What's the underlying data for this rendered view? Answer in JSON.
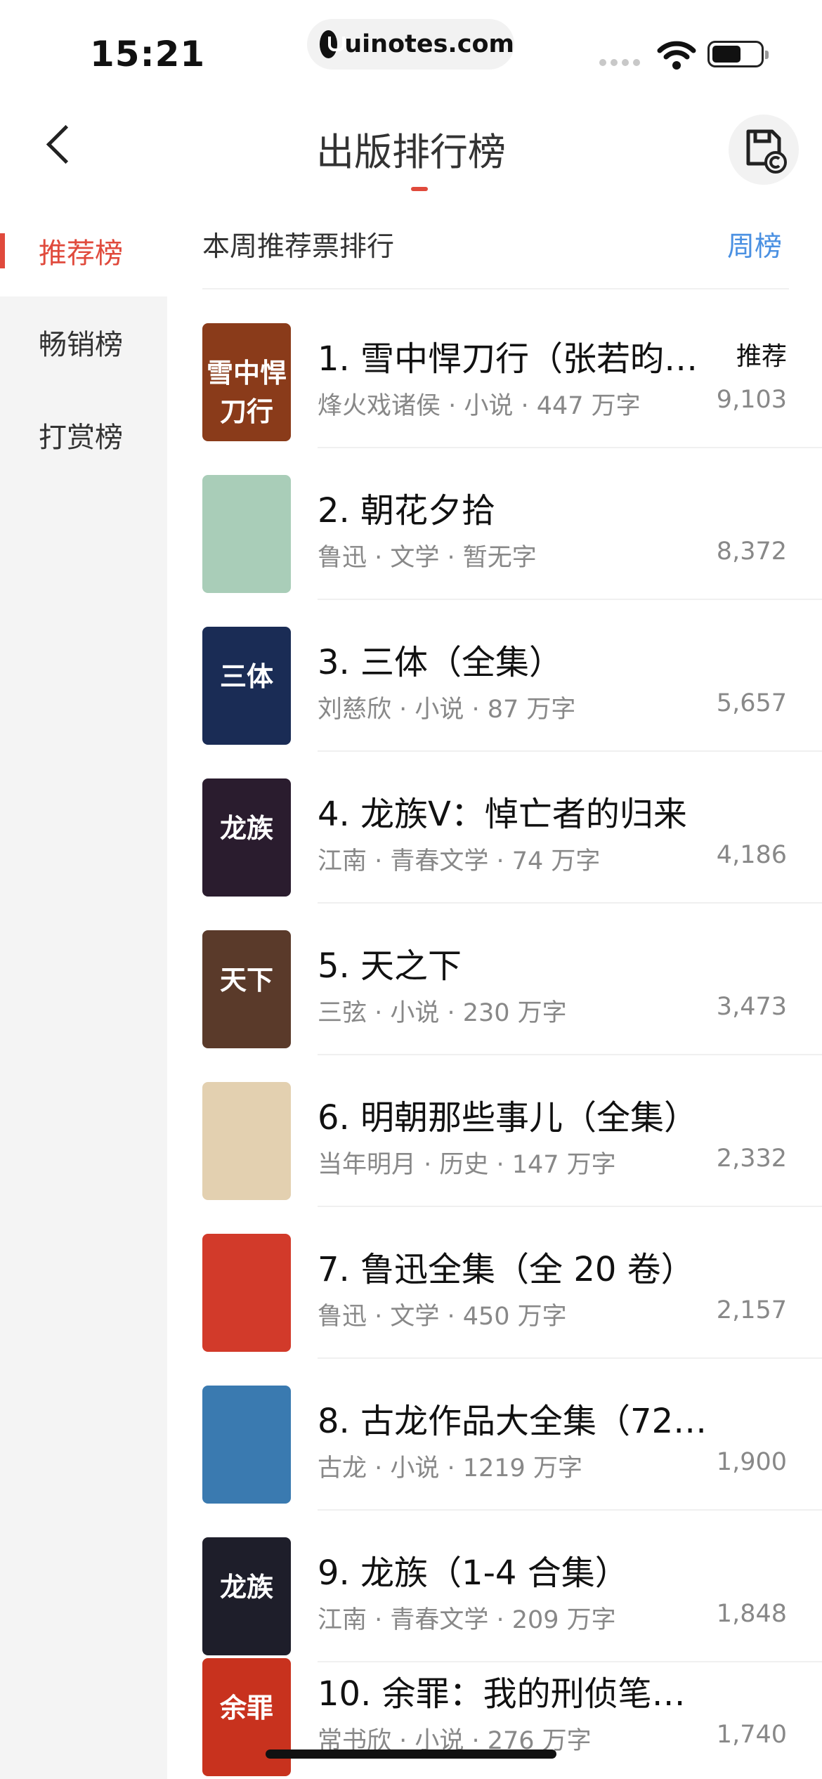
{
  "status_bar": {
    "time": "15:21",
    "url": "uinotes.com"
  },
  "header": {
    "title": "出版排行榜",
    "back_icon": "chevron-left-icon",
    "action_icon": "save-copyright-icon"
  },
  "sidebar": {
    "items": [
      {
        "label": "推荐榜",
        "active": true
      },
      {
        "label": "畅销榜",
        "active": false
      },
      {
        "label": "打赏榜",
        "active": false
      }
    ]
  },
  "section": {
    "title": "本周推荐票排行",
    "switch_label": "周榜"
  },
  "books": [
    {
      "name": "1. 雪中悍刀行（张若昀、…",
      "meta": "烽火戏诸侯 · 小说 · 447 万字",
      "tag": "推荐",
      "count": "9,103",
      "cover_color": "#8a3b1a",
      "cover_text": "雪中悍刀行"
    },
    {
      "name": "2. 朝花夕拾",
      "meta": "鲁迅 · 文学 · 暂无字",
      "tag": "",
      "count": "8,372",
      "cover_color": "#a9cdb8",
      "cover_text": ""
    },
    {
      "name": "3. 三体（全集）",
      "meta": "刘慈欣 · 小说 · 87 万字",
      "tag": "",
      "count": "5,657",
      "cover_color": "#1a2c55",
      "cover_text": "三体"
    },
    {
      "name": "4. 龙族Ⅴ：悼亡者的归来",
      "meta": "江南 · 青春文学 · 74 万字",
      "tag": "",
      "count": "4,186",
      "cover_color": "#2a1c2e",
      "cover_text": "龙族"
    },
    {
      "name": "5. 天之下",
      "meta": "三弦 · 小说 · 230 万字",
      "tag": "",
      "count": "3,473",
      "cover_color": "#5a3a2a",
      "cover_text": "天下"
    },
    {
      "name": "6. 明朝那些事儿（全集）",
      "meta": "当年明月 · 历史 · 147 万字",
      "tag": "",
      "count": "2,332",
      "cover_color": "#e3d0b0",
      "cover_text": ""
    },
    {
      "name": "7. 鲁迅全集（全 20 卷）",
      "meta": "鲁迅 · 文学 · 450 万字",
      "tag": "",
      "count": "2,157",
      "cover_color": "#d23a2a",
      "cover_text": ""
    },
    {
      "name": "8. 古龙作品大全集（72…",
      "meta": "古龙 · 小说 · 1219 万字",
      "tag": "",
      "count": "1,900",
      "cover_color": "#3a7ab0",
      "cover_text": ""
    },
    {
      "name": "9. 龙族（1-4 合集）",
      "meta": "江南 · 青春文学 · 209 万字",
      "tag": "",
      "count": "1,848",
      "cover_color": "#1e1e2a",
      "cover_text": "龙族"
    },
    {
      "name": "10. 余罪：我的刑侦笔记…",
      "meta": "常书欣 · 小说 · 276 万字",
      "tag": "",
      "count": "1,740",
      "cover_color": "#c8321e",
      "cover_text": "余罪"
    }
  ]
}
